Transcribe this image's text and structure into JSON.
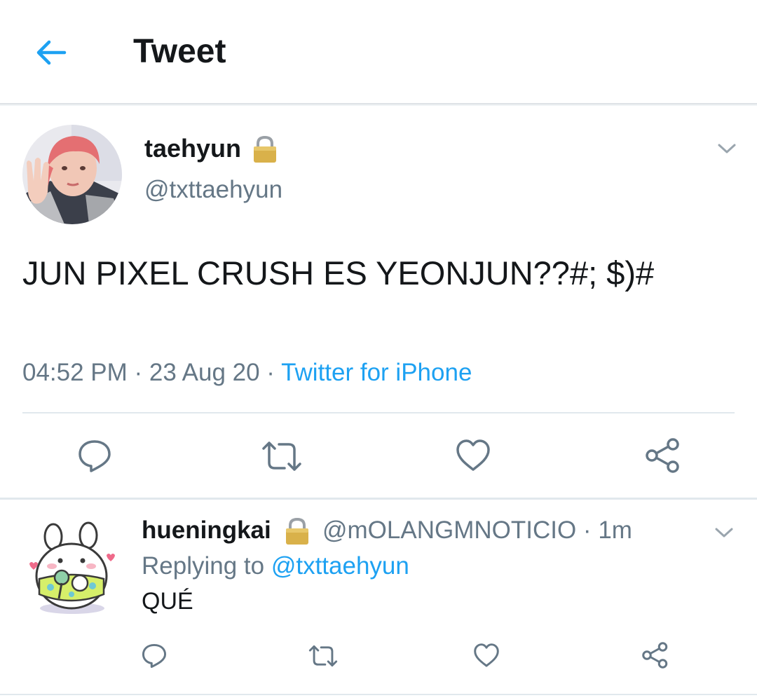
{
  "header": {
    "title": "Tweet",
    "back_icon": "arrow-left-icon",
    "accent": "#1da1f2"
  },
  "tweet": {
    "display_name": "taehyun",
    "handle": "@txttaehyun",
    "text": "JUN PIXEL CRUSH ES YEONJUN??#; $)#",
    "time": "04:52 PM",
    "sep1": " · ",
    "date": "23 Aug 20",
    "sep2": " · ",
    "source": "Twitter for iPhone",
    "icons": [
      "lock-icon",
      "chevron-down-icon",
      "reply-icon",
      "retweet-icon",
      "like-icon",
      "share-icon"
    ]
  },
  "reply": {
    "display_name": "hueningkai",
    "handle": "@mOLANGMNOTICIO",
    "sep": " · ",
    "time": "1m",
    "replying_prefix": "Replying to ",
    "replying_to": "@txttaehyun",
    "text": "QUÉ"
  },
  "colors": {
    "text": "#14171a",
    "secondary": "#657786",
    "link": "#1da1f2",
    "divider": "#e1e8ed"
  }
}
